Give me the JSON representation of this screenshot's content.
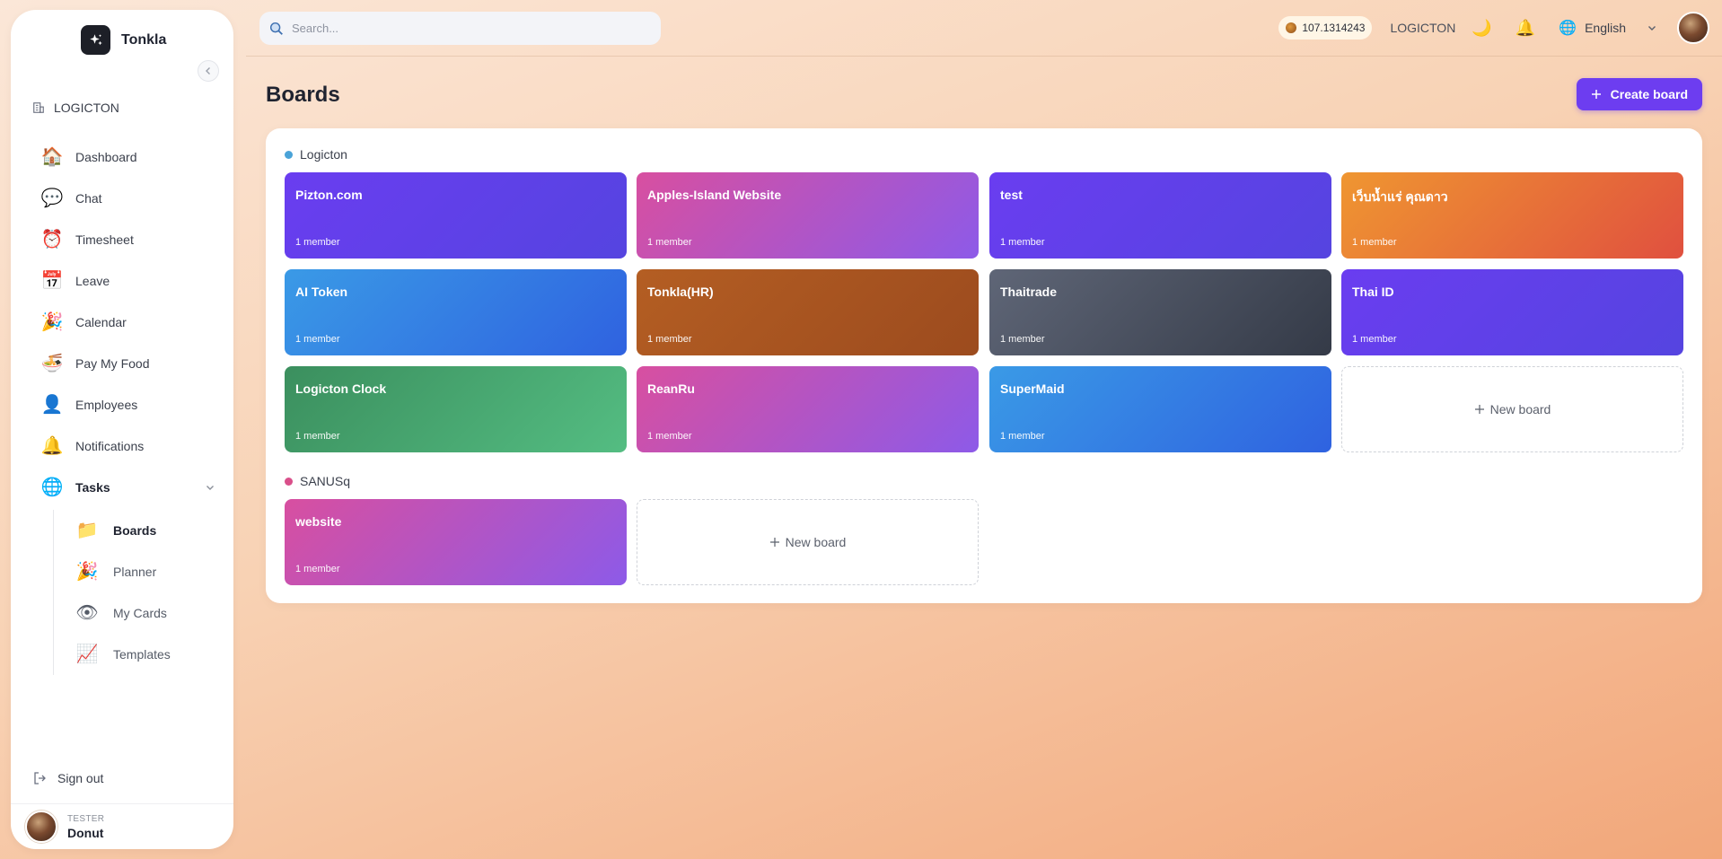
{
  "brand": {
    "name": "Tonkla"
  },
  "org": {
    "name": "LOGICTON"
  },
  "sidebar": {
    "items": [
      {
        "label": "Dashboard",
        "icon": "house-icon"
      },
      {
        "label": "Chat",
        "icon": "chat-bubbles-icon"
      },
      {
        "label": "Timesheet",
        "icon": "alarm-clock-icon"
      },
      {
        "label": "Leave",
        "icon": "calendar-grid-icon"
      },
      {
        "label": "Calendar",
        "icon": "party-popper-icon"
      },
      {
        "label": "Pay My Food",
        "icon": "noodle-bowl-icon"
      },
      {
        "label": "Employees",
        "icon": "person-icon"
      },
      {
        "label": "Notifications",
        "icon": "bell-icon"
      }
    ],
    "tasks": {
      "label": "Tasks",
      "icon": "globe-icon"
    },
    "sub_items": [
      {
        "label": "Boards",
        "icon": "folder-icon",
        "active": true
      },
      {
        "label": "Planner",
        "icon": "party-popper-icon"
      },
      {
        "label": "My Cards",
        "icon": "eye-icon"
      },
      {
        "label": "Templates",
        "icon": "chart-increasing-icon"
      }
    ],
    "signout_label": "Sign out",
    "user": {
      "role": "TESTER",
      "name": "Donut"
    }
  },
  "topbar": {
    "search_placeholder": "Search...",
    "token_balance": "107.1314243",
    "company": "LOGICTON",
    "language": "English"
  },
  "main": {
    "title": "Boards",
    "create_label": "Create board",
    "new_board_label": "New board",
    "groups": [
      {
        "name": "Logicton",
        "color": "#4aa3d8",
        "boards": [
          {
            "name": "Pizton.com",
            "members": "1 member",
            "gradient": [
              "#6a3df0",
              "#5544e0"
            ]
          },
          {
            "name": "Apples-Island Website",
            "members": "1 member",
            "gradient": [
              "#d84fa0",
              "#8d5ae8"
            ]
          },
          {
            "name": "test",
            "members": "1 member",
            "gradient": [
              "#6a3df0",
              "#5544e0"
            ]
          },
          {
            "name": "เว็บน้ำแร่ คุณดาว",
            "members": "1 member",
            "gradient": [
              "#ef9631",
              "#e0503f"
            ]
          },
          {
            "name": "AI Token",
            "members": "1 member",
            "gradient": [
              "#3a9ae6",
              "#2f62e0"
            ]
          },
          {
            "name": "Tonkla(HR)",
            "members": "1 member",
            "gradient": [
              "#b45e23",
              "#9c4b1e"
            ]
          },
          {
            "name": "Thaitrade",
            "members": "1 member",
            "gradient": [
              "#5f6677",
              "#343a47"
            ]
          },
          {
            "name": "Thai ID",
            "members": "1 member",
            "gradient": [
              "#6a3df0",
              "#5544e0"
            ]
          },
          {
            "name": "Logicton Clock",
            "members": "1 member",
            "gradient": [
              "#3b8f5e",
              "#54bd82"
            ]
          },
          {
            "name": "ReanRu",
            "members": "1 member",
            "gradient": [
              "#d84fa0",
              "#8d5ae8"
            ]
          },
          {
            "name": "SuperMaid",
            "members": "1 member",
            "gradient": [
              "#3a9ae6",
              "#2f62e0"
            ]
          }
        ]
      },
      {
        "name": "SANUSq",
        "color": "#d94f8a",
        "boards": [
          {
            "name": "website",
            "members": "1 member",
            "gradient": [
              "#d84fa0",
              "#8d5ae8"
            ]
          }
        ]
      }
    ]
  }
}
